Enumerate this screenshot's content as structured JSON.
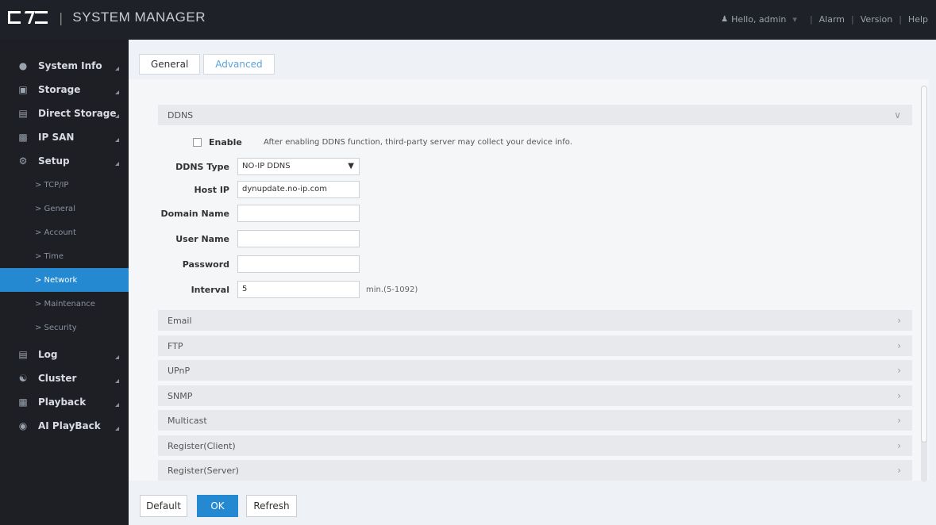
{
  "header": {
    "app_title": "SYSTEM MANAGER",
    "user_link": "Hello, admin",
    "alarm_link": "Alarm",
    "version_link": "Version",
    "help_link": "Help"
  },
  "sidebar": {
    "items": [
      {
        "label": "System Info",
        "icon": "info-icon"
      },
      {
        "label": "Storage",
        "icon": "storage-icon"
      },
      {
        "label": "Direct Storage",
        "icon": "direct-storage-icon"
      },
      {
        "label": "IP SAN",
        "icon": "ip-san-icon"
      },
      {
        "label": "Setup",
        "icon": "gear-icon"
      }
    ],
    "sub_items": [
      {
        "label": "> TCP/IP"
      },
      {
        "label": "> General"
      },
      {
        "label": "> Account"
      },
      {
        "label": "> Time"
      },
      {
        "label": "> Network",
        "active": true
      },
      {
        "label": "> Maintenance"
      },
      {
        "label": "> Security"
      }
    ],
    "bottom_items": [
      {
        "label": "Log",
        "icon": "log-icon"
      },
      {
        "label": "Cluster",
        "icon": "cluster-icon"
      },
      {
        "label": "Playback",
        "icon": "playback-icon"
      },
      {
        "label": "AI PlayBack",
        "icon": "ai-playback-icon"
      }
    ]
  },
  "tabs": [
    {
      "label": "General",
      "active": true
    },
    {
      "label": "Advanced",
      "active": false
    }
  ],
  "ddns": {
    "title": "DDNS",
    "enable_label": "Enable",
    "enable_checked": false,
    "note": "After enabling DDNS function, third-party server may collect your device info.",
    "type_label": "DDNS Type",
    "type_value": "NO-IP DDNS",
    "host_label": "Host IP",
    "host_value": "dynupdate.no-ip.com",
    "domain_label": "Domain Name",
    "domain_value": "",
    "user_label": "User Name",
    "user_value": "",
    "password_label": "Password",
    "password_value": "",
    "interval_label": "Interval",
    "interval_value": "5",
    "interval_suffix": "min.(5-1092)"
  },
  "sections": [
    {
      "label": "Email"
    },
    {
      "label": "FTP"
    },
    {
      "label": "UPnP"
    },
    {
      "label": "SNMP"
    },
    {
      "label": "Multicast"
    },
    {
      "label": "Register(Client)"
    },
    {
      "label": "Register(Server)"
    }
  ],
  "footer": {
    "default_label": "Default",
    "ok_label": "OK",
    "refresh_label": "Refresh"
  },
  "colors": {
    "accent": "#2589d1",
    "sidebar_bg": "#1d1f25",
    "topbar_bg": "#1f2128"
  }
}
